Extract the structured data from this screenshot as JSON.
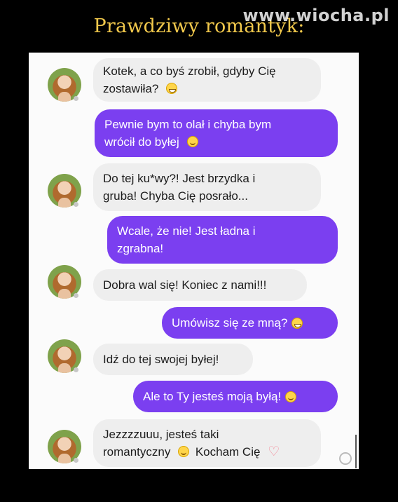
{
  "header": {
    "title": "Prawdziwy romantyk:",
    "watermark": "www.wiocha.pl"
  },
  "messages": [
    {
      "side": "incoming",
      "lines": [
        "Kotek, a co byś zrobił, gdyby Cię",
        "zostawiła?"
      ],
      "emoji": "grinning-face"
    },
    {
      "side": "outgoing",
      "lines": [
        "Pewnie bym to olał i chyba bym",
        "wrócił do byłej"
      ],
      "emoji": "smiling-face"
    },
    {
      "side": "incoming",
      "lines": [
        "Do tej ku*wy?! Jest brzydka i",
        "gruba! Chyba Cię posrało..."
      ],
      "emoji": ""
    },
    {
      "side": "outgoing",
      "lines": [
        "Wcale, że nie! Jest ładna i",
        "zgrabna!"
      ],
      "emoji": ""
    },
    {
      "side": "incoming",
      "lines": [
        "Dobra wal się! Koniec z nami!!!"
      ],
      "emoji": ""
    },
    {
      "side": "outgoing",
      "lines": [
        "Umówisz się ze mną?"
      ],
      "emoji": "grinning-face"
    },
    {
      "side": "incoming",
      "lines": [
        "Idź do tej swojej byłej!"
      ],
      "emoji": ""
    },
    {
      "side": "outgoing",
      "lines": [
        "Ale to Ty jesteś moją byłą!"
      ],
      "emoji": "smiling-face"
    },
    {
      "side": "incoming",
      "lines": [
        "Jezzzzuuu, jesteś taki",
        "romantyczny"
      ],
      "emoji": "smiling-face",
      "tail": "Kocham Cię",
      "tail_emoji": "heart"
    }
  ],
  "colors": {
    "outgoing_bubble": "#7b3ff0",
    "incoming_bubble": "#eeeeee",
    "title": "#f2c94c"
  }
}
